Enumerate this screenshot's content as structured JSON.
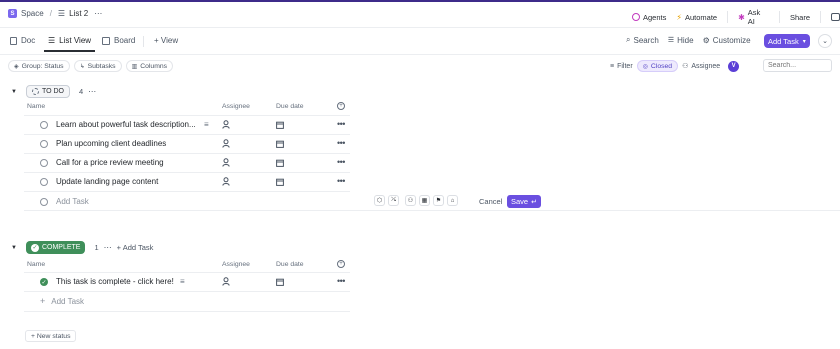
{
  "breadcrumb": {
    "space_badge": "S",
    "space": "Space",
    "separator": "/",
    "list": "List 2",
    "more": "⋯"
  },
  "header_actions": {
    "agents": "Agents",
    "automate": "Automate",
    "ask_ai": "Ask AI",
    "share": "Share"
  },
  "views": {
    "doc": "Doc",
    "list_view": "List View",
    "board": "Board",
    "add_view": "+ View"
  },
  "toolbar": {
    "search": "Search",
    "hide": "Hide",
    "customize": "Customize",
    "add_task": "Add Task"
  },
  "filters": {
    "group": "Group: Status",
    "subtasks": "Subtasks",
    "columns": "Columns",
    "filter": "Filter",
    "closed": "Closed",
    "assignee": "Assignee",
    "avatar": "V",
    "search_placeholder": "Search..."
  },
  "todo_group": {
    "status": "TO DO",
    "count": "4",
    "more": "⋯",
    "columns": {
      "name": "Name",
      "assignee": "Assignee",
      "due": "Due date"
    },
    "tasks": [
      {
        "name": "Learn about powerful task description..."
      },
      {
        "name": "Plan upcoming client deadlines"
      },
      {
        "name": "Call for a price review meeting"
      },
      {
        "name": "Update landing page content"
      }
    ],
    "add_task": "Add Task",
    "cancel": "Cancel",
    "save": "Save"
  },
  "complete_group": {
    "status": "COMPLETE",
    "count": "1",
    "more": "⋯",
    "add_task_header": "+ Add Task",
    "columns": {
      "name": "Name",
      "assignee": "Assignee",
      "due": "Due date"
    },
    "tasks": [
      {
        "name": "This task is complete - click here!"
      }
    ],
    "add_task": "Add Task"
  },
  "new_status": "+ New status",
  "colors": {
    "accent": "#7b68ee",
    "complete": "#3f8f5a",
    "topbar": "#3d2b8a"
  }
}
